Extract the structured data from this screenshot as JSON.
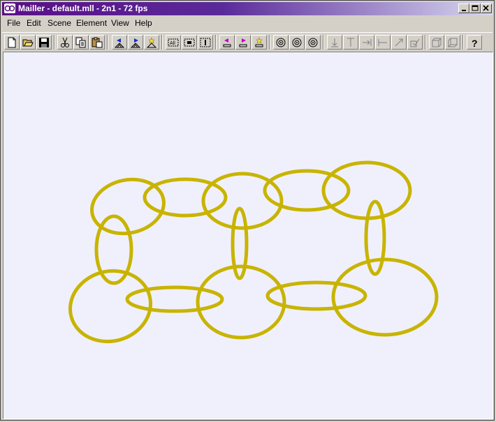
{
  "window": {
    "title": "Mailler - default.mll - 2n1 - 72 fps"
  },
  "menubar": {
    "items": [
      "File",
      "Edit",
      "Scene",
      "Element",
      "View",
      "Help"
    ]
  },
  "toolbar": {
    "icons": [
      "new-file-icon",
      "open-folder-icon",
      "save-icon",
      "cut-icon",
      "copy-icon",
      "paste-icon",
      "blue-arrow-left-icon",
      "blue-arrow-right-icon",
      "star-up-icon",
      "select-all-icon",
      "select-box-icon",
      "select-frame-icon",
      "magenta-arrow-left-icon",
      "magenta-arrow-right-icon",
      "yellow-star-icon",
      "target-1-icon",
      "target-2-icon",
      "target-3-icon",
      "align-down-icon",
      "align-top-icon",
      "align-right-icon",
      "align-left-icon",
      "diagonal-arrow-icon",
      "check-icon",
      "box-front-icon",
      "box-back-icon",
      "help-icon"
    ]
  },
  "scene": {
    "ring_color": "#c8b400",
    "background": "#f0f0fc"
  }
}
